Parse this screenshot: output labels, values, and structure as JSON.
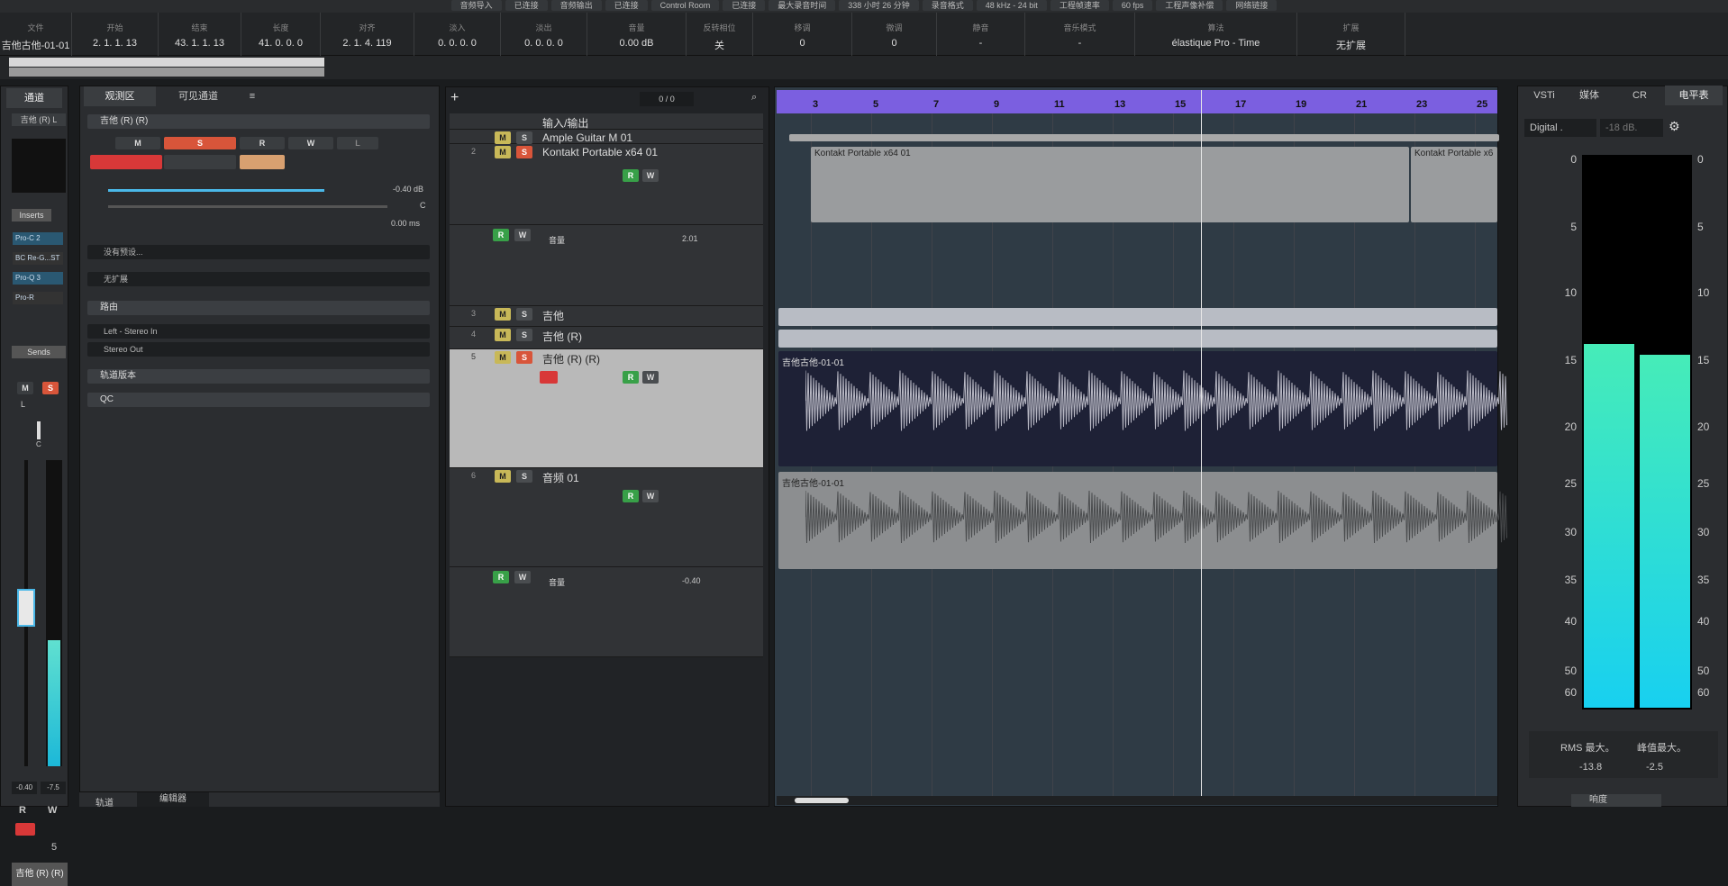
{
  "transport_strip": [
    "音频导入",
    "已连接",
    "音频输出",
    "已连接",
    "Control Room",
    "已连接",
    "最大录音时间",
    "338 小时 26 分钟",
    "录音格式",
    "48 kHz - 24 bit",
    "工程帧速率",
    "60 fps",
    "工程声像补偿",
    "网络链接"
  ],
  "info_line": [
    {
      "h": "文件",
      "v": "吉他古他-01-01"
    },
    {
      "h": "开始",
      "v": "2. 1. 1. 13"
    },
    {
      "h": "结束",
      "v": "43. 1. 1. 13"
    },
    {
      "h": "长度",
      "v": "41. 0. 0. 0"
    },
    {
      "h": "对齐",
      "v": "2. 1. 4. 119"
    },
    {
      "h": "淡入",
      "v": "0. 0. 0. 0"
    },
    {
      "h": "淡出",
      "v": "0. 0. 0. 0"
    },
    {
      "h": "音量",
      "v": "0.00  dB"
    },
    {
      "h": "反转相位",
      "v": "关"
    },
    {
      "h": "移调",
      "v": "0"
    },
    {
      "h": "微调",
      "v": "0"
    },
    {
      "h": "静音",
      "v": "-"
    },
    {
      "h": "音乐模式",
      "v": "-"
    },
    {
      "h": "算法",
      "v": "élastique Pro - Time"
    },
    {
      "h": "扩展",
      "v": "无扩展"
    }
  ],
  "left_zone_tabs": {
    "channel": "通道",
    "inspector": "观测区",
    "visibility": "可见通道",
    "menu": "≡"
  },
  "channel_strip": {
    "name": "吉他 (R) L",
    "inserts_label": "Inserts",
    "inserts": [
      "Pro-C 2",
      "BC Re-G...ST",
      "Pro-Q 3",
      "Pro-R"
    ],
    "sends_label": "Sends",
    "m": "M",
    "s": "S",
    "l": "L",
    "c": "C",
    "vol": "-0.40",
    "peak": "-7.5",
    "r": "R",
    "w": "W",
    "num": "5",
    "bottom_name": "吉他 (R) (R)",
    "bottom_tabs": [
      "轨道",
      "编辑器"
    ]
  },
  "inspector": {
    "track_name": "吉他 (R) (R)",
    "m": "M",
    "s": "S",
    "r": "R",
    "w": "W",
    "l": "L",
    "vol": "-0.40 dB",
    "pan": "C",
    "delay": "0.00 ms",
    "input_hint": "没有预设...",
    "extension": "无扩展",
    "routing": "路由",
    "input": "Left - Stereo In",
    "output": "Stereo Out",
    "version": "轨道版本",
    "qc": "QC"
  },
  "track_toolbar": {
    "counter": "0 / 0"
  },
  "tracks": [
    {
      "num": "",
      "name": "输入/输出",
      "kind": "folder"
    },
    {
      "num": "",
      "name": "Ample Guitar M 01"
    },
    {
      "num": "2",
      "name": "Kontakt Portable x64 01"
    },
    {
      "num": "",
      "name": "音量",
      "value": "2.01",
      "kind": "auto"
    },
    {
      "num": "3",
      "name": "吉他"
    },
    {
      "num": "4",
      "name": "吉他 (R)"
    },
    {
      "num": "5",
      "name": "吉他 (R) (R)"
    },
    {
      "num": "6",
      "name": "音频 01"
    },
    {
      "num": "",
      "name": "音量",
      "value": "-0.40",
      "kind": "auto"
    }
  ],
  "ruler": [
    "3",
    "5",
    "7",
    "9",
    "11",
    "13",
    "15",
    "17",
    "19",
    "21",
    "23",
    "25"
  ],
  "parts": {
    "kontakt1": "Kontakt Portable x64 01",
    "kontakt2": "Kontakt Portable x6",
    "audio5": "吉他古他-01-01",
    "audio6": "吉他古他-01-01"
  },
  "right_zone": {
    "tabs": [
      "VSTi",
      "媒体",
      "CR",
      "电平表"
    ],
    "mode": "Digital .",
    "ref": "-18 dB.",
    "scale": [
      "0",
      "5",
      "10",
      "15",
      "20",
      "25",
      "30",
      "35",
      "40",
      "50",
      "60"
    ],
    "rms_label": "RMS 最大。",
    "peak_label": "峰值最大。",
    "rms": "-13.8",
    "peak": "-2.5",
    "bottom_tab": "响度",
    "meter_l": 0.66,
    "meter_r": 0.64
  },
  "colors": {
    "accent_purple": "#7b5fe0",
    "mute": "#c8b858",
    "solo": "#d8553a",
    "read": "#38a048",
    "meter": "#2ad8c8"
  }
}
